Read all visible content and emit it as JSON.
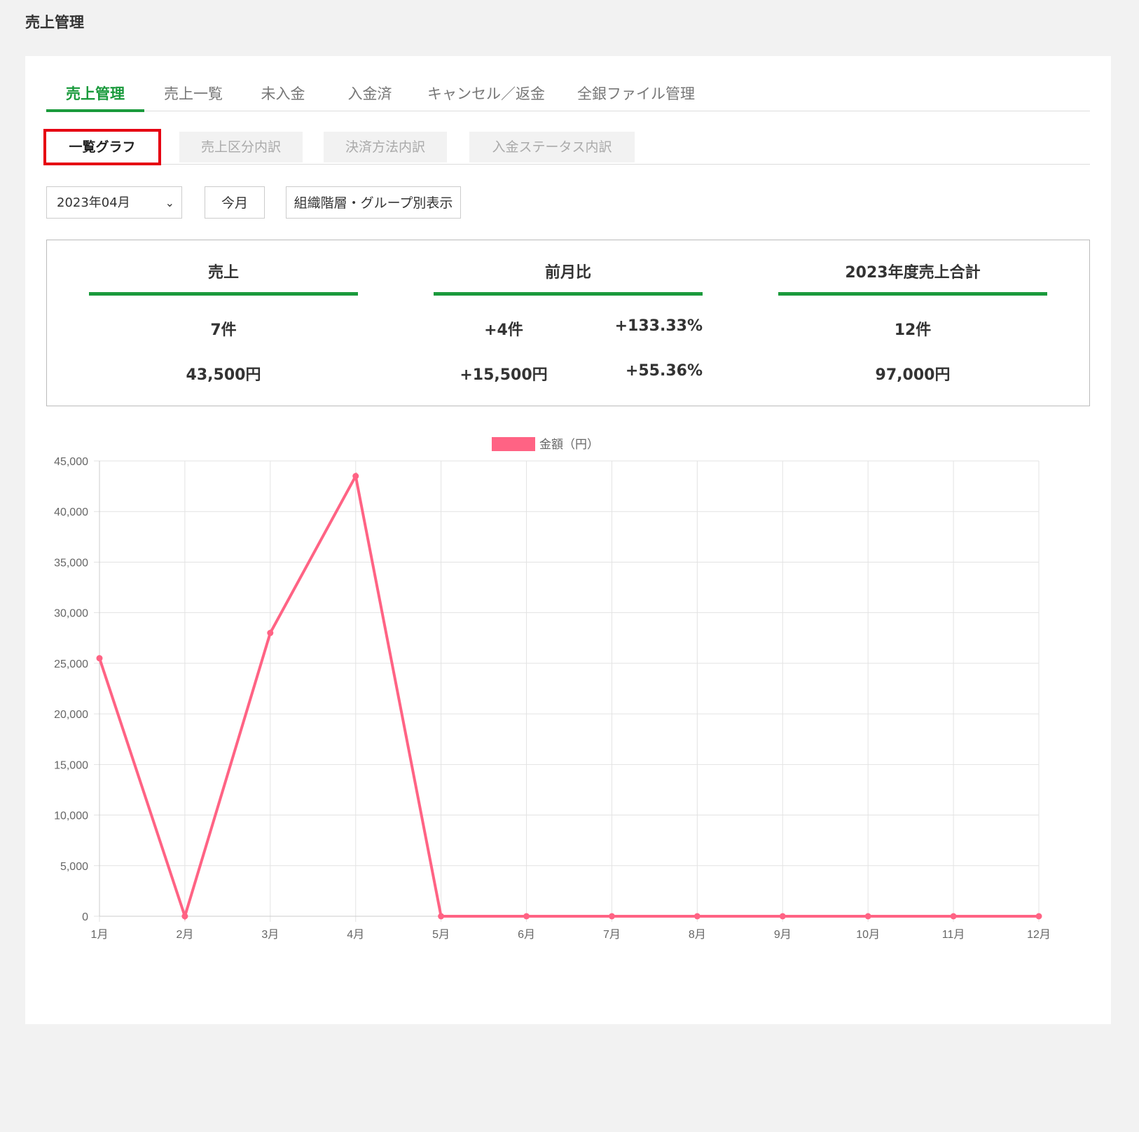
{
  "header": {
    "title": "売上管理"
  },
  "main_tabs": [
    {
      "label": "売上管理"
    },
    {
      "label": "売上一覧"
    },
    {
      "label": "未入金"
    },
    {
      "label": "入金済"
    },
    {
      "label": "キャンセル／返金"
    },
    {
      "label": "全銀ファイル管理"
    }
  ],
  "sub_tabs": [
    {
      "label": "一覧グラフ"
    },
    {
      "label": "売上区分内訳"
    },
    {
      "label": "決済方法内訳"
    },
    {
      "label": "入金ステータス内訳"
    }
  ],
  "controls": {
    "month_value": "2023年04月",
    "current_month_label": "今月",
    "group_view_label": "組織階層・グループ別表示"
  },
  "summary": {
    "sales": {
      "title": "売上",
      "count": "7件",
      "amount": "43,500円"
    },
    "mom": {
      "title": "前月比",
      "count_diff": "+4件",
      "count_pct": "+133.33%",
      "amount_diff": "+15,500円",
      "amount_pct": "+55.36%"
    },
    "fiscal": {
      "title": "2023年度売上合計",
      "count": "12件",
      "amount": "97,000円"
    }
  },
  "colors": {
    "accent": "#1a9a3c",
    "highlight": "#e60012",
    "line": "#ff6384"
  },
  "chart_data": {
    "type": "line",
    "legend": "金額（円）",
    "categories": [
      "1月",
      "2月",
      "3月",
      "4月",
      "5月",
      "6月",
      "7月",
      "8月",
      "9月",
      "10月",
      "11月",
      "12月"
    ],
    "series": [
      {
        "name": "金額（円）",
        "values": [
          25500,
          0,
          28000,
          43500,
          0,
          0,
          0,
          0,
          0,
          0,
          0,
          0
        ]
      }
    ],
    "ylim": [
      0,
      45000
    ],
    "yticks": [
      0,
      5000,
      10000,
      15000,
      20000,
      25000,
      30000,
      35000,
      40000,
      45000
    ],
    "grid": true,
    "legend_position": "top"
  }
}
